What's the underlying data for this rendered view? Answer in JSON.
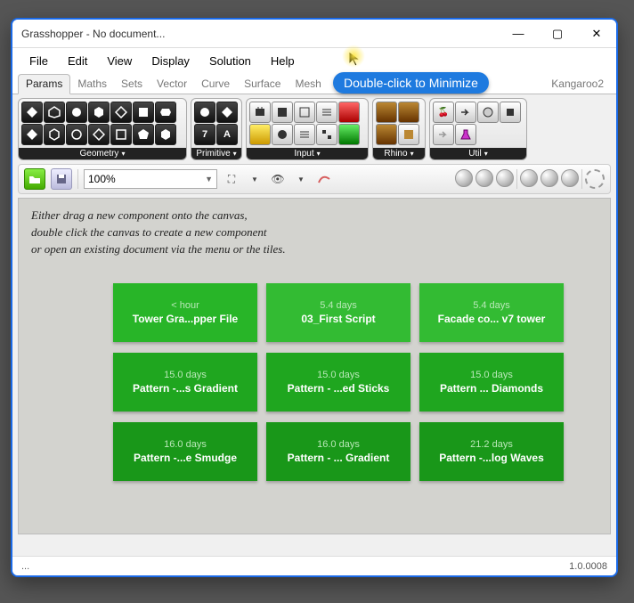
{
  "title": "Grasshopper - No document...",
  "winbuttons": {
    "min": "—",
    "max": "▢",
    "close": "✕"
  },
  "menubar": [
    "File",
    "Edit",
    "View",
    "Display",
    "Solution",
    "Help"
  ],
  "tabs": [
    "Params",
    "Maths",
    "Sets",
    "Vector",
    "Curve",
    "Surface",
    "Mesh",
    "Kangaroo2"
  ],
  "active_tab": 0,
  "tooltip": "Double-click to Minimize",
  "panels": {
    "geometry": "Geometry",
    "primitive": "Primitive",
    "input": "Input",
    "rhino": "Rhino",
    "util": "Util"
  },
  "zoom": "100%",
  "hint": {
    "l1": "Either drag a new component onto the canvas,",
    "l2": "double click the canvas to create a new component",
    "l3": "or open an existing document via the menu or the tiles."
  },
  "tiles": [
    {
      "age": "< hour",
      "name": "Tower Gra...pper File"
    },
    {
      "age": "5.4 days",
      "name": "03_First Script"
    },
    {
      "age": "5.4 days",
      "name": "Facade co... v7 tower"
    },
    {
      "age": "15.0 days",
      "name": "Pattern -...s Gradient"
    },
    {
      "age": "15.0 days",
      "name": "Pattern - ...ed Sticks"
    },
    {
      "age": "15.0 days",
      "name": "Pattern ... Diamonds"
    },
    {
      "age": "16.0 days",
      "name": "Pattern -...e Smudge"
    },
    {
      "age": "16.0 days",
      "name": "Pattern - ... Gradient"
    },
    {
      "age": "21.2 days",
      "name": "Pattern -...log Waves"
    }
  ],
  "status": {
    "left": "...",
    "right": "1.0.0008"
  }
}
